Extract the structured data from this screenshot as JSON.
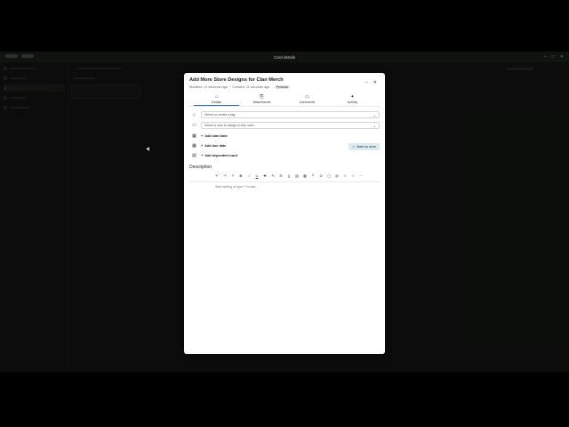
{
  "window": {
    "title": "Card details"
  },
  "card": {
    "title": "Add More Store Designs for Clan Merch",
    "modified": "Modified: 11 seconds ago",
    "separator": "·",
    "created": "Created: 11 seconds ago",
    "badge": "Personal"
  },
  "tabs": [
    {
      "label": "Details",
      "icon": "home-icon"
    },
    {
      "label": "Attachments",
      "icon": "attachment-icon"
    },
    {
      "label": "Comments",
      "icon": "comment-icon"
    },
    {
      "label": "Activity",
      "icon": "activity-icon"
    }
  ],
  "fields": {
    "tag_placeholder": "Select or create a tag...",
    "assignee_placeholder": "Select a user to assign to this card..."
  },
  "actions": {
    "start_date": "Add start date",
    "due_date": "Add due date",
    "dependent": "Add dependent card",
    "mark_done": "Mark as done"
  },
  "description": {
    "label": "Description",
    "placeholder": "Start writing or type '/' to add..."
  },
  "colors": {
    "accent": "#2b6cb0",
    "done_bg": "#dceaf1"
  }
}
